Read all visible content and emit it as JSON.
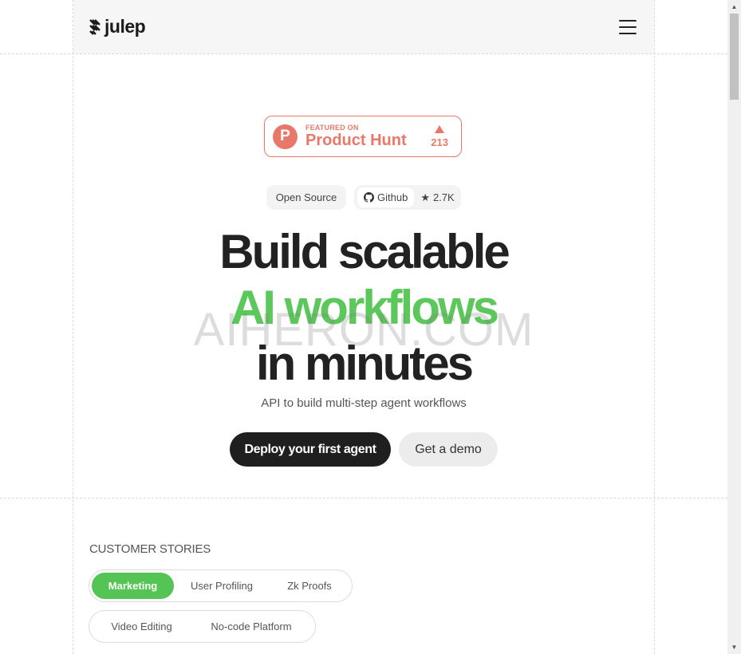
{
  "header": {
    "logo_text": "julep",
    "menu_label": "menu"
  },
  "product_hunt": {
    "featured_on": "FEATURED ON",
    "name": "Product Hunt",
    "votes": "213",
    "accent": "#e8786a"
  },
  "pills": {
    "open_source": "Open Source",
    "github": "Github",
    "stars": "2.7K"
  },
  "hero": {
    "line1": "Build scalable",
    "line2": "AI workflows",
    "line3": "in minutes",
    "subtitle": "API to build multi-step agent workflows",
    "accent": "#5cc85c"
  },
  "watermark": "AIHERON.COM",
  "cta": {
    "primary": "Deploy your first agent",
    "secondary": "Get a demo"
  },
  "customer_stories": {
    "label": "CUSTOMER STORIES",
    "tabs_row1": [
      "Marketing",
      "User Profiling",
      "Zk Proofs"
    ],
    "tabs_row2": [
      "Video Editing",
      "No-code Platform"
    ],
    "active": "Marketing"
  }
}
